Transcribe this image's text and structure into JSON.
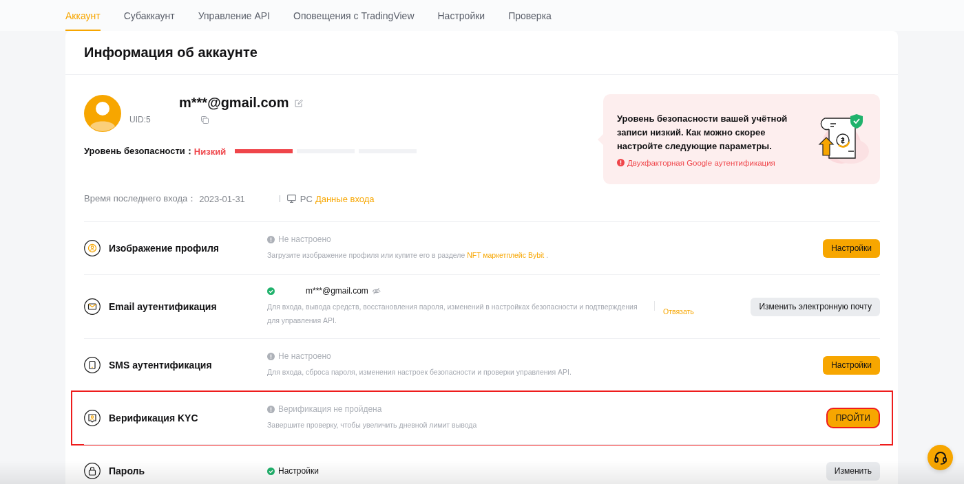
{
  "tabs": [
    {
      "label": "Аккаунт",
      "selected": true
    },
    {
      "label": "Субаккаунт",
      "selected": false
    },
    {
      "label": "Управление API",
      "selected": false
    },
    {
      "label": "Оповещения с TradingView",
      "selected": false
    },
    {
      "label": "Настройки",
      "selected": false
    },
    {
      "label": "Проверка",
      "selected": false
    }
  ],
  "card": {
    "title": "Информация об аккаунте",
    "profile": {
      "email": "m***@gmail.com",
      "uid": "UID:5",
      "security_label": "Уровень безопасности：",
      "security_value": "Низкий",
      "security_segments": [
        {
          "filled": true
        },
        {
          "filled": false
        },
        {
          "filled": false
        }
      ],
      "last_login_label": "Время последнего входа：",
      "last_login_value": "2023-01-31",
      "device": "PC",
      "login_link": "Данные входа"
    },
    "alert": {
      "message": "Уровень безопасности вашей учётной записи низкий. Как можно скорее настройте следующие параметры.",
      "items": [
        "Двухфакторная Google аутентификация"
      ]
    },
    "rows": [
      {
        "kind": "avatar",
        "title": "Изображение профиля",
        "status": {
          "done": false,
          "text": "Не настроено"
        },
        "description": "Загрузите изображение профиля или купите его в разделе ",
        "link": "NFT маркетплейс Bybit",
        "description_after": " .",
        "button": {
          "label": "Настройки"
        },
        "highlighted": false
      },
      {
        "kind": "mail",
        "title": "Email аутентификация",
        "status": {
          "done": true,
          "text": "m***@gmail.com",
          "masked": true
        },
        "description": "Для входа, вывода средств, восстановления пароля, изменений в настройках безопасности и подтверждения для управления API.",
        "side_link": "Отвязать",
        "button": {
          "label": "Изменить электронную почту"
        },
        "highlighted": false
      },
      {
        "kind": "phone",
        "title": "SMS аутентификация",
        "status": {
          "done": false,
          "text": "Не настроено"
        },
        "description": "Для входа, сброса пароля, изменения настроек безопасности и проверки управления API.",
        "button": {
          "label": "Настройки"
        },
        "highlighted": false
      },
      {
        "kind": "kyc",
        "title": "Верификация KYC",
        "status": {
          "done": false,
          "text": "Верификация не пройдена"
        },
        "description": "Завершите проверку, чтобы увеличить дневной лимит вывода",
        "button": {
          "label": "ПРОЙТИ"
        },
        "highlighted": true
      },
      {
        "kind": "lock",
        "title": "Пароль",
        "status": {
          "done": true,
          "text": "Настройки"
        },
        "button": {
          "label": "Изменить"
        },
        "highlighted": false
      }
    ]
  }
}
